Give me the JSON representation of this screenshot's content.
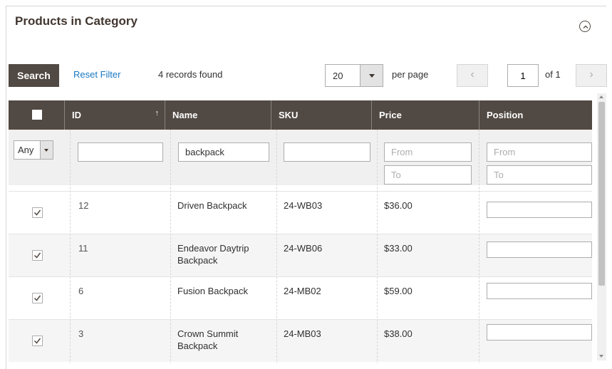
{
  "panel": {
    "title": "Products in Category"
  },
  "toolbar": {
    "search_label": "Search",
    "reset_label": "Reset Filter",
    "records_text": "4 records found",
    "per_page_value": "20",
    "per_page_label": "per page",
    "page_value": "1",
    "page_total": "of 1",
    "prev_glyph": "‹",
    "next_glyph": "›"
  },
  "grid": {
    "columns": [
      "ID",
      "Name",
      "SKU",
      "Price",
      "Position"
    ],
    "filters": {
      "visibility": "Any",
      "id": "",
      "name": "backpack",
      "sku": "",
      "price_from_placeholder": "From",
      "price_to_placeholder": "To",
      "position_from_placeholder": "From",
      "position_to_placeholder": "To"
    },
    "rows": [
      {
        "checked": true,
        "id": "12",
        "name": "Driven Backpack",
        "sku": "24-WB03",
        "price": "$36.00",
        "position": ""
      },
      {
        "checked": true,
        "id": "11",
        "name": "Endeavor Daytrip Backpack",
        "sku": "24-WB06",
        "price": "$33.00",
        "position": ""
      },
      {
        "checked": true,
        "id": "6",
        "name": "Fusion Backpack",
        "sku": "24-MB02",
        "price": "$59.00",
        "position": ""
      },
      {
        "checked": true,
        "id": "3",
        "name": "Crown Summit Backpack",
        "sku": "24-MB03",
        "price": "$38.00",
        "position": ""
      }
    ]
  },
  "colors": {
    "header_bg": "#514943",
    "link": "#1979c3",
    "title": "#41362f"
  }
}
